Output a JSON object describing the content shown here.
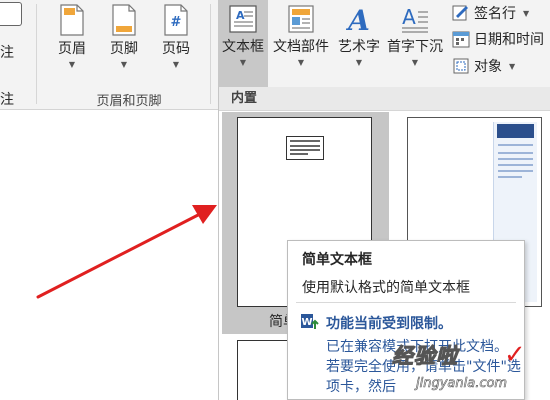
{
  "ribbon": {
    "edge_labels": [
      "注",
      "注"
    ],
    "header_footer_group": {
      "label": "页眉和页脚",
      "buttons": [
        {
          "label": "页眉",
          "icon": "page-header-icon"
        },
        {
          "label": "页脚",
          "icon": "page-footer-icon"
        },
        {
          "label": "页码",
          "icon": "page-number-icon"
        }
      ]
    },
    "text_group": {
      "buttons": [
        {
          "label": "文本框",
          "icon": "text-box-icon",
          "active": true
        },
        {
          "label": "文档部件",
          "icon": "quick-parts-icon"
        },
        {
          "label": "艺术字",
          "icon": "wordart-icon"
        },
        {
          "label": "首字下沉",
          "icon": "drop-cap-icon"
        }
      ],
      "small_buttons": [
        {
          "label": "签名行",
          "icon": "signature-line-icon"
        },
        {
          "label": "日期和时间",
          "icon": "date-time-icon"
        },
        {
          "label": "对象",
          "icon": "object-icon"
        }
      ]
    }
  },
  "dropdown": {
    "section_header": "内置",
    "items": [
      {
        "caption": "简单文本框",
        "caption_visible": "简单"
      },
      {
        "caption": ""
      },
      {
        "caption": ""
      }
    ],
    "tooltip": {
      "title": "简单文本框",
      "description": "使用默认格式的简单文本框",
      "warning_title": "功能当前受到限制。",
      "warning_body": "已在兼容模式下打开此文档。若要完全使用，请单击\"文件\"选项卡，然后"
    }
  },
  "watermark": {
    "main": "经验啦",
    "sub": "jingyanla.com",
    "check": "✓"
  },
  "colors": {
    "ribbon_bg": "#f3f3f3",
    "active_button": "#c8c8c8",
    "link_blue": "#2b579a",
    "arrow_red": "#e02020"
  }
}
